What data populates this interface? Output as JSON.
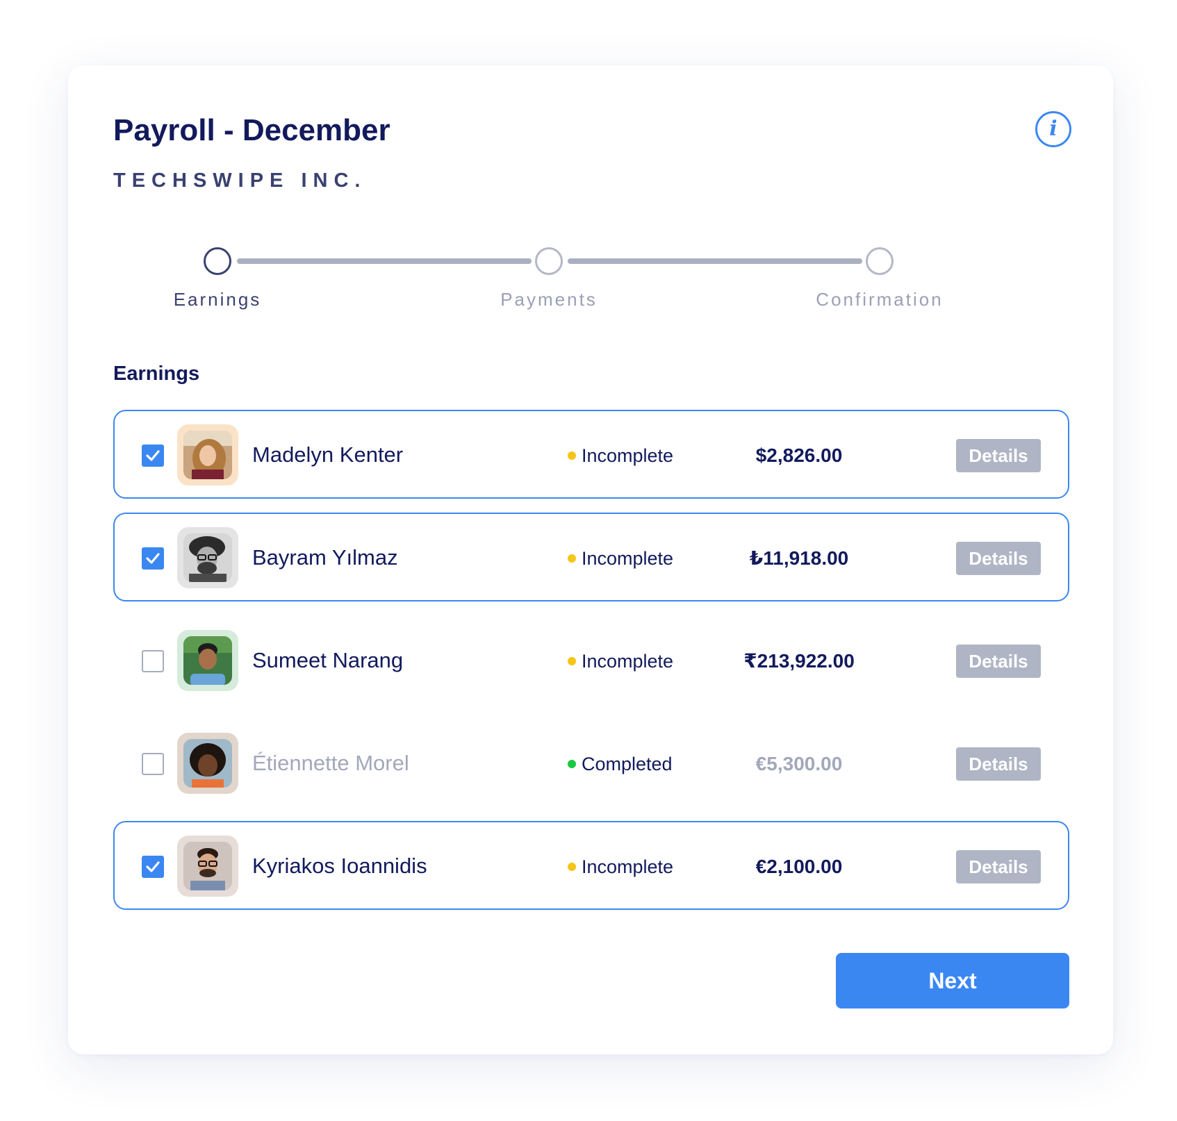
{
  "header": {
    "title": "Payroll - December",
    "company": "TECHSWIPE INC.",
    "info_icon": "i"
  },
  "stepper": {
    "steps": [
      {
        "label": "Earnings",
        "state": "active"
      },
      {
        "label": "Payments",
        "state": "inactive"
      },
      {
        "label": "Confirmation",
        "state": "inactive"
      }
    ]
  },
  "earnings": {
    "section_title": "Earnings",
    "rows": [
      {
        "name": "Madelyn Kenter",
        "checked": true,
        "status": "Incomplete",
        "status_color": "#f5c518",
        "amount": "$2,826.00",
        "details_label": "Details",
        "avatar_icon": "avatar-photo",
        "muted": false
      },
      {
        "name": "Bayram Yılmaz",
        "checked": true,
        "status": "Incomplete",
        "status_color": "#f5c518",
        "amount": "₺11,918.00",
        "details_label": "Details",
        "avatar_icon": "avatar-photo",
        "muted": false
      },
      {
        "name": "Sumeet Narang",
        "checked": false,
        "status": "Incomplete",
        "status_color": "#f5c518",
        "amount": "₹213,922.00",
        "details_label": "Details",
        "avatar_icon": "avatar-photo",
        "muted": false
      },
      {
        "name": "Étiennette Morel",
        "checked": false,
        "status": "Completed",
        "status_color": "#19c93f",
        "amount": "€5,300.00",
        "details_label": "Details",
        "avatar_icon": "avatar-photo",
        "muted": true
      },
      {
        "name": "Kyriakos Ioannidis",
        "checked": true,
        "status": "Incomplete",
        "status_color": "#f5c518",
        "amount": "€2,100.00",
        "details_label": "Details",
        "avatar_icon": "avatar-photo",
        "muted": false
      }
    ]
  },
  "footer": {
    "next_label": "Next"
  },
  "colors": {
    "accent": "#3b87f2",
    "heading": "#121a5c",
    "muted_text": "#a2a8ba",
    "details_button": "#afb5c4",
    "incomplete": "#f5c518",
    "completed": "#19c93f"
  }
}
